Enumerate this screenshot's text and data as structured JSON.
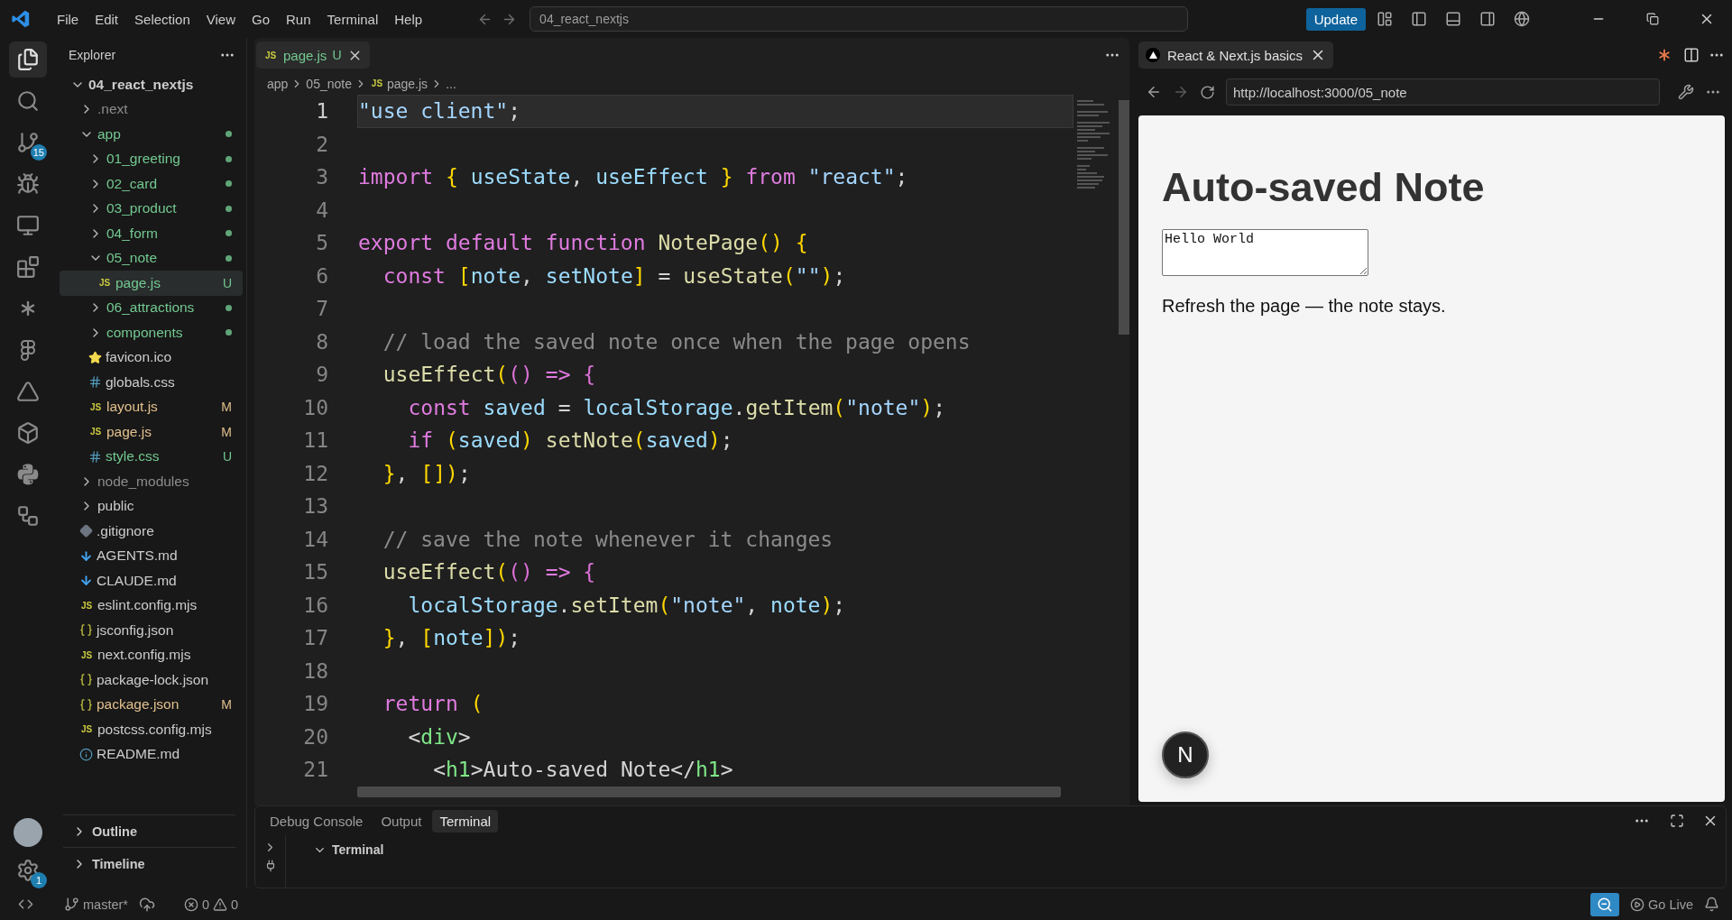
{
  "title_bar": {
    "menu": [
      "File",
      "Edit",
      "Selection",
      "View",
      "Go",
      "Run",
      "Terminal",
      "Help"
    ],
    "command_center": "04_react_nextjs",
    "update_button": "Update"
  },
  "activity_bar": {
    "source_control_badge": "15",
    "settings_badge": "1"
  },
  "explorer": {
    "title": "Explorer",
    "root": {
      "name": "04_react_nextjs",
      "kind": "folder",
      "expanded": true,
      "color": "#cccccc",
      "dot": false,
      "selected": false,
      "children": [
        {
          "name": ".next",
          "kind": "folder",
          "expanded": false,
          "color": "#8c8c8c",
          "dot": false,
          "selected": false
        },
        {
          "name": "app",
          "kind": "folder",
          "expanded": true,
          "color": "#73c991",
          "dot": true,
          "selected": false,
          "children": [
            {
              "name": "01_greeting",
              "kind": "folder",
              "expanded": false,
              "color": "#73c991",
              "dot": true,
              "selected": false
            },
            {
              "name": "02_card",
              "kind": "folder",
              "expanded": false,
              "color": "#73c991",
              "dot": true,
              "selected": false
            },
            {
              "name": "03_product",
              "kind": "folder",
              "expanded": false,
              "color": "#73c991",
              "dot": true,
              "selected": false
            },
            {
              "name": "04_form",
              "kind": "folder",
              "expanded": false,
              "color": "#73c991",
              "dot": true,
              "selected": false
            },
            {
              "name": "05_note",
              "kind": "folder",
              "expanded": true,
              "color": "#73c991",
              "dot": true,
              "selected": false,
              "children": [
                {
                  "name": "page.js",
                  "kind": "script",
                  "type_label": "JS",
                  "color": "#73c991",
                  "decoration": "U",
                  "dot": false,
                  "selected": true
                }
              ]
            },
            {
              "name": "06_attractions",
              "kind": "folder",
              "expanded": false,
              "color": "#73c991",
              "dot": true,
              "selected": false
            },
            {
              "name": "components",
              "kind": "folder",
              "expanded": false,
              "color": "#73c991",
              "dot": true,
              "selected": false
            },
            {
              "name": "favicon.ico",
              "kind": "favicon",
              "color": "#cccccc",
              "dot": false,
              "selected": false
            },
            {
              "name": "globals.css",
              "kind": "stylesheet",
              "color": "#cccccc",
              "dot": false,
              "selected": false
            },
            {
              "name": "layout.js",
              "kind": "script",
              "type_label": "JS",
              "color": "#e2c08d",
              "decoration": "M",
              "dot": false,
              "selected": false
            },
            {
              "name": "page.js",
              "kind": "script",
              "type_label": "JS",
              "color": "#e2c08d",
              "decoration": "M",
              "dot": false,
              "selected": false
            },
            {
              "name": "style.css",
              "kind": "stylesheet",
              "color": "#73c991",
              "decoration": "U",
              "dot": false,
              "selected": false
            }
          ]
        },
        {
          "name": "node_modules",
          "kind": "folder",
          "expanded": false,
          "color": "#8c8c8c",
          "dot": false,
          "selected": false
        },
        {
          "name": "public",
          "kind": "folder",
          "expanded": false,
          "color": "#cccccc",
          "dot": false,
          "selected": false
        },
        {
          "name": ".gitignore",
          "kind": "gitignore",
          "color": "#cccccc",
          "dot": false,
          "selected": false
        },
        {
          "name": "AGENTS.md",
          "kind": "markdown",
          "color": "#cccccc",
          "dot": false,
          "selected": false
        },
        {
          "name": "CLAUDE.md",
          "kind": "markdown",
          "color": "#cccccc",
          "dot": false,
          "selected": false
        },
        {
          "name": "eslint.config.mjs",
          "kind": "script",
          "type_label": "JS",
          "color": "#cccccc",
          "dot": false,
          "selected": false
        },
        {
          "name": "jsconfig.json",
          "kind": "data",
          "color": "#cccccc",
          "dot": false,
          "selected": false
        },
        {
          "name": "next.config.mjs",
          "kind": "script",
          "type_label": "JS",
          "color": "#cccccc",
          "dot": false,
          "selected": false
        },
        {
          "name": "package-lock.json",
          "kind": "data",
          "color": "#cccccc",
          "dot": false,
          "selected": false
        },
        {
          "name": "package.json",
          "kind": "data",
          "color": "#e2c08d",
          "decoration": "M",
          "dot": false,
          "selected": false
        },
        {
          "name": "postcss.config.mjs",
          "kind": "script",
          "type_label": "JS",
          "color": "#cccccc",
          "dot": false,
          "selected": false
        },
        {
          "name": "README.md",
          "kind": "info",
          "color": "#cccccc",
          "dot": false,
          "selected": false
        }
      ]
    },
    "sections": [
      {
        "title": "Outline",
        "expanded": false
      },
      {
        "title": "Timeline",
        "expanded": false
      }
    ]
  },
  "editor": {
    "tabs": [
      {
        "name": "page.js",
        "type_label": "JS",
        "decoration": "U",
        "selected": true
      }
    ],
    "breadcrumbs": [
      {
        "text": "app"
      },
      {
        "text": "05_note"
      },
      {
        "type_label": "JS",
        "text": "page.js"
      },
      {
        "text": "..."
      }
    ],
    "lines": [
      {
        "number": "1",
        "current": true,
        "text": "\"use client\";"
      },
      {
        "number": "2",
        "current": false
      },
      {
        "number": "3",
        "current": false,
        "text": "import { useState, useEffect } from \"react\";"
      },
      {
        "number": "4",
        "current": false
      },
      {
        "number": "5",
        "current": false,
        "text": "export default function NotePage() {"
      },
      {
        "number": "6",
        "current": false,
        "text": "  const [note, setNote] = useState(\"\");"
      },
      {
        "number": "7",
        "current": false
      },
      {
        "number": "8",
        "current": false,
        "text": "  // load the saved note once when the page opens"
      },
      {
        "number": "9",
        "current": false,
        "text": "  useEffect(() => {"
      },
      {
        "number": "10",
        "current": false,
        "text": "    const saved = localStorage.getItem(\"note\");"
      },
      {
        "number": "11",
        "current": false,
        "text": "    if (saved) setNote(saved);"
      },
      {
        "number": "12",
        "current": false,
        "text": "  }, []);"
      },
      {
        "number": "13",
        "current": false
      },
      {
        "number": "14",
        "current": false,
        "text": "  // save the note whenever it changes"
      },
      {
        "number": "15",
        "current": false,
        "text": "  useEffect(() => {"
      },
      {
        "number": "16",
        "current": false,
        "text": "    localStorage.setItem(\"note\", note);"
      },
      {
        "number": "17",
        "current": false,
        "text": "  }, [note]);"
      },
      {
        "number": "18",
        "current": false
      },
      {
        "number": "19",
        "current": false,
        "text": "  return ("
      },
      {
        "number": "20",
        "current": false,
        "text": "    <div>"
      },
      {
        "number": "21",
        "current": false,
        "text": "      <h1>Auto-saved Note</h1>"
      }
    ]
  },
  "browser": {
    "tab": {
      "title": "React & Next.js basics"
    },
    "url": "http://localhost:3000/05_note",
    "forward_disabled": true,
    "page": {
      "heading": "Auto-saved Note",
      "textarea_value": "Hello World",
      "text": "Refresh the page — the note stays.",
      "dev_badge": "N"
    }
  },
  "panel": {
    "tabs": [
      {
        "label": "Debug Console",
        "selected": false
      },
      {
        "label": "Output",
        "selected": false
      },
      {
        "label": "Terminal",
        "selected": true
      }
    ],
    "section": {
      "title": "Terminal",
      "expanded": true
    }
  },
  "status_bar": {
    "branch": "master*",
    "errors": "0",
    "warnings": "0",
    "go_live": "Go Live"
  }
}
